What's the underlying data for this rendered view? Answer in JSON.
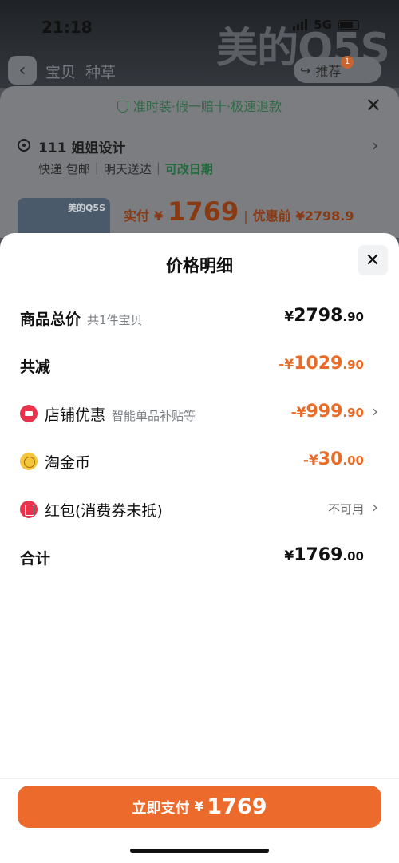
{
  "status_bar": {
    "time": "21:18",
    "network": "5G"
  },
  "background": {
    "watermark": "美的Q5S",
    "tabs": [
      "宝贝",
      "种草"
    ],
    "share_label": "推荐",
    "badge_count": "1"
  },
  "sku": {
    "guarantee": "准时装·假一赔十·极速退款",
    "address": "111 姐姐设计",
    "shipping": [
      "快递 包邮",
      "明天送达"
    ],
    "shipping_highlight": "可改日期",
    "thumb_label": "美的Q5S",
    "paid_label": "实付",
    "paid_currency": "¥",
    "paid_amount": "1769",
    "before_label": "优惠前",
    "before_amount": "¥2798.9"
  },
  "detail": {
    "title": "价格明细",
    "rows": [
      {
        "label": "商品总价",
        "sub": "共1件宝贝",
        "currency": "¥",
        "int": "2798",
        "dec": ".90"
      },
      {
        "label": "共减",
        "currency": "-¥",
        "int": "1029",
        "dec": ".90"
      },
      {
        "icon": "store-coupon-icon",
        "label": "店铺优惠",
        "sub": "智能单品补贴等",
        "currency": "-¥",
        "int": "999",
        "dec": ".90"
      },
      {
        "icon": "gold-coin-icon",
        "label": "淘金币",
        "currency": "-¥",
        "int": "30",
        "dec": ".00"
      },
      {
        "icon": "red-packet-icon",
        "label": "红包(消费券未抵)",
        "value": "不可用"
      },
      {
        "label": "合计",
        "currency": "¥",
        "int": "1769",
        "dec": ".00"
      }
    ],
    "pay_button": {
      "text": "立即支付",
      "currency": "¥",
      "amount": "1769"
    }
  },
  "colors": {
    "accent": "#ec6a2b",
    "discount": "#ea6b27",
    "green": "#1f6b3c"
  }
}
